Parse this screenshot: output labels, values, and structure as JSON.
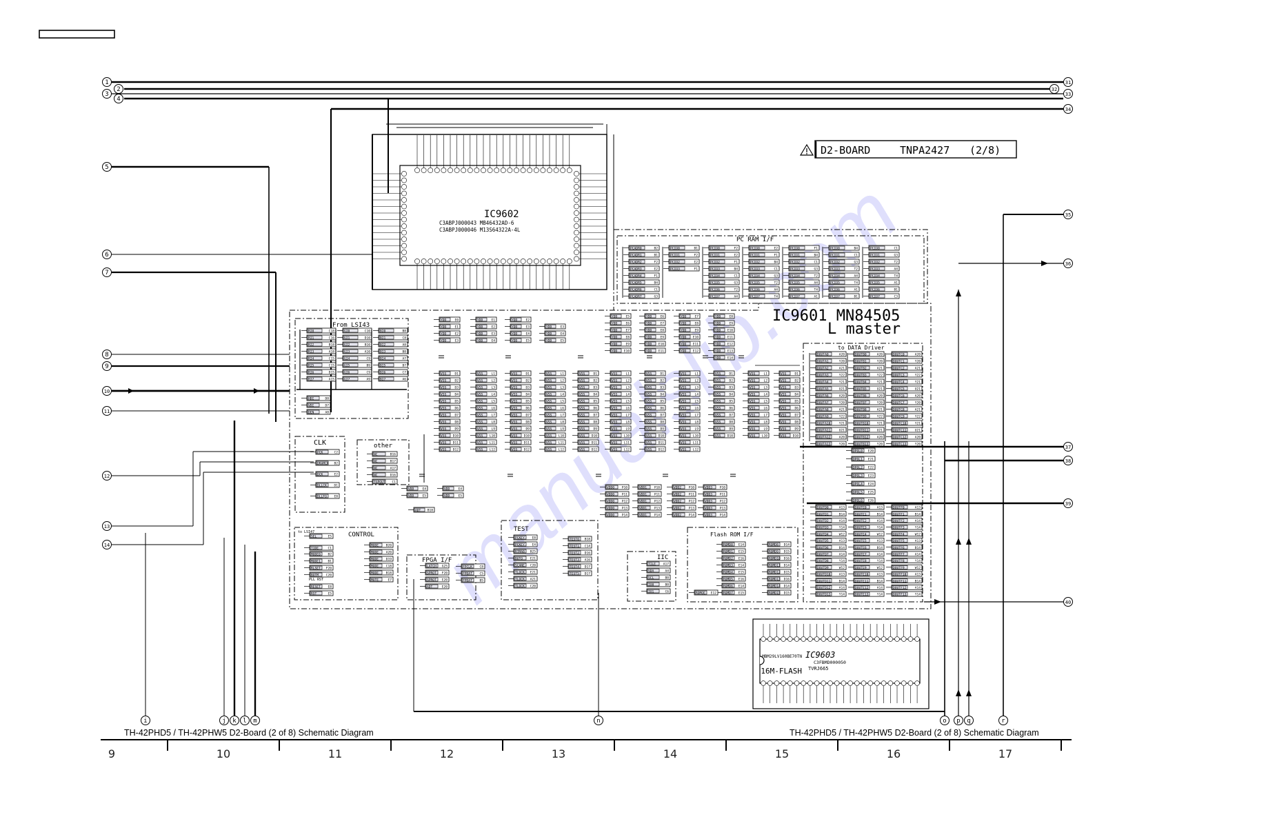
{
  "page": {
    "header_box_label": "",
    "footer_title_left": "TH-42PHD5 / TH-42PHW5  D2-Board (2 of 8) Schematic Diagram",
    "footer_title_right": "TH-42PHD5 / TH-42PHW5  D2-Board (2 of 8) Schematic Diagram",
    "grid_columns": [
      "9",
      "10",
      "11",
      "12",
      "13",
      "14",
      "15",
      "16",
      "17"
    ],
    "watermark": "manualslib.com"
  },
  "title_block": {
    "warning_icon": "warning-triangle-icon",
    "board": "D2-BOARD",
    "part_number": "TNPA2427",
    "sheet": "(2/8)"
  },
  "components": {
    "ic9602": {
      "ref": "IC9602",
      "part_1": "C3ABPJ000043 MB46432AD-6",
      "part_2": "C3ABPJ000046 M13S64322A-4L"
    },
    "ic9601": {
      "ref": "IC9601 MN84505",
      "subtitle": "L master"
    },
    "ic9603": {
      "ref": "IC9603",
      "part_1": "MBM29LV160BE70TN",
      "part_2": "C3FBMD000050",
      "type": "16M-FLASH",
      "part_3": "TVRJ665"
    }
  },
  "blocks": {
    "from_lsi": "From LSI43",
    "clk": "CLK",
    "other": "other",
    "control": "CONTROL",
    "fpga": "FPGA I/F",
    "test": "TEST",
    "iic": "IIC",
    "flash_rom": "Flash ROM I/F",
    "pc_ram": "PC RAM I/F",
    "data_driver": "to DATA Driver",
    "control_sub_1": "to LSI47",
    "control_sub_2": "PLL RST"
  },
  "from_lsi_pins": [
    [
      "RI0",
      "C18"
    ],
    [
      "RI1",
      "C16"
    ],
    [
      "RI2",
      "B18"
    ],
    [
      "RI3",
      "A18"
    ],
    [
      "RI4",
      "C15"
    ],
    [
      "RI5",
      "C15"
    ],
    [
      "RI6",
      "D15"
    ],
    [
      "RI7",
      "A15"
    ],
    [
      "GI0",
      "C10"
    ],
    [
      "GI1",
      "D10"
    ],
    [
      "GI2",
      "B10"
    ],
    [
      "GI3",
      "A10"
    ],
    [
      "GI4",
      "C9"
    ],
    [
      "GI5",
      "B9"
    ],
    [
      "GI6",
      "C9"
    ],
    [
      "GI7",
      "A9"
    ],
    [
      "BI0",
      "B8"
    ],
    [
      "BI1",
      "C8"
    ],
    [
      "BI2",
      "A8"
    ],
    [
      "BI3",
      "B8"
    ],
    [
      "BI4",
      "A7"
    ],
    [
      "BI5",
      "B7"
    ],
    [
      "BI6",
      "C7"
    ],
    [
      "BI7",
      "A6"
    ]
  ],
  "sync_pins": [
    [
      "HDI",
      "D8"
    ],
    [
      "VDI",
      "D7"
    ],
    [
      "DEN",
      "A8"
    ]
  ],
  "clk_pins": [
    [
      "PCK",
      "C2"
    ],
    [
      "DRAMCK",
      "B2"
    ],
    [
      "DCK",
      "E2"
    ],
    [
      "DLLCK",
      "D1"
    ],
    [
      "DLLFO",
      "E8"
    ]
  ],
  "other_pins": [
    [
      "NC",
      "B16"
    ],
    [
      "NC",
      "B17"
    ],
    [
      "NC",
      "A17"
    ],
    [
      "NC",
      "D16"
    ],
    [
      "TGPOUT",
      "C1"
    ]
  ],
  "iic_pins": [
    [
      "TILE",
      "A17"
    ],
    [
      "SDA",
      "A4"
    ],
    [
      "SCL",
      "B8"
    ],
    [
      "IO0",
      "B8"
    ],
    [
      "IO1",
      "C6"
    ]
  ],
  "connectors_left": [
    "1",
    "2",
    "3",
    "4",
    "5",
    "6",
    "7",
    "8",
    "9",
    "10",
    "11",
    "12",
    "13",
    "14"
  ],
  "connectors_right": [
    "31",
    "32",
    "33",
    "34",
    "35",
    "36",
    "37",
    "38",
    "39",
    "40"
  ],
  "connectors_bottom": [
    "i",
    "j",
    "k",
    "l",
    "m",
    "n",
    "o",
    "p",
    "q",
    "r"
  ],
  "colors": {
    "ink": "#000000",
    "paper": "#ffffff",
    "pin_fill": "#e6e6ee",
    "watermark": "#3c3cf0"
  }
}
